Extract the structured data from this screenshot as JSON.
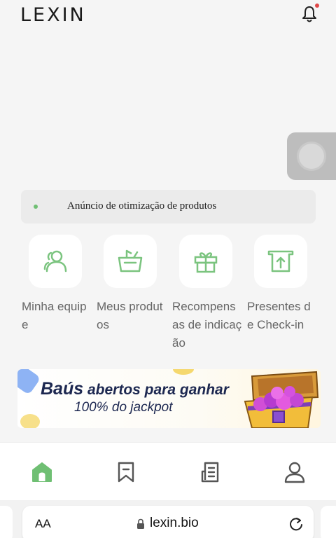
{
  "header": {
    "logo": "LEXIN",
    "icon": "bell-icon",
    "has_notification": true
  },
  "notice": {
    "text": "Anúncio de otimização de produtos"
  },
  "features": [
    {
      "label": "Minha equipe",
      "icon": "team-icon"
    },
    {
      "label": "Meus produtos",
      "icon": "basket-icon"
    },
    {
      "label": "Recompensas de indicação",
      "icon": "gift-icon"
    },
    {
      "label": "Presentes de Check-in",
      "icon": "checkin-icon"
    }
  ],
  "banner": {
    "line1_highlight": "Baús",
    "line1_rest": " abertos para ganhar",
    "line2": "100% do jackpot"
  },
  "bottom_nav": {
    "items": [
      {
        "icon": "home-icon",
        "active": true
      },
      {
        "icon": "bookmark-icon",
        "active": false
      },
      {
        "icon": "orders-icon",
        "active": false
      },
      {
        "icon": "profile-icon",
        "active": false
      }
    ]
  },
  "browser": {
    "text_size": "AA",
    "url": "lexin.bio"
  },
  "colors": {
    "accent": "#6fbf73",
    "text_muted": "#666666",
    "banner_text": "#1c2750"
  }
}
